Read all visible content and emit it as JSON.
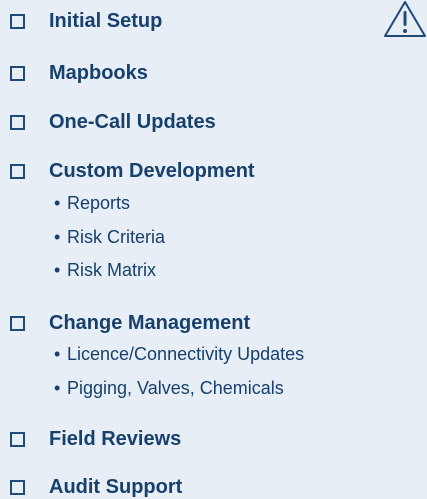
{
  "items": [
    {
      "label": "Initial Setup",
      "subitems": []
    },
    {
      "label": "Mapbooks",
      "subitems": []
    },
    {
      "label": "One-Call Updates",
      "subitems": []
    },
    {
      "label": "Custom Development",
      "subitems": [
        "Reports",
        "Risk Criteria",
        "Risk Matrix"
      ]
    },
    {
      "label": "Change Management",
      "subitems": [
        "Licence/Connectivity Updates",
        "Pigging, Valves, Chemicals"
      ]
    },
    {
      "label": "Field Reviews",
      "subitems": []
    },
    {
      "label": "Audit Support",
      "subitems": []
    }
  ],
  "bullet": "•",
  "icons": {
    "warning": "warning-icon",
    "checkbox": "checkbox-icon"
  },
  "colors": {
    "text": "#17406c",
    "checkbox_border": "#1f4a79",
    "background": "#e7eef6"
  }
}
